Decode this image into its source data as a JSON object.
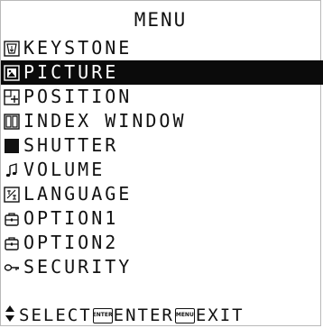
{
  "menu": {
    "title": "MENU",
    "items": [
      {
        "label": "KEYSTONE",
        "icon": "keystone-icon",
        "selected": false
      },
      {
        "label": "PICTURE",
        "icon": "picture-icon",
        "selected": true
      },
      {
        "label": "POSITION",
        "icon": "position-icon",
        "selected": false
      },
      {
        "label": "INDEX WINDOW",
        "icon": "index-window-icon",
        "selected": false
      },
      {
        "label": "SHUTTER",
        "icon": "shutter-icon",
        "selected": false
      },
      {
        "label": "VOLUME",
        "icon": "volume-icon",
        "selected": false
      },
      {
        "label": "LANGUAGE",
        "icon": "language-icon",
        "selected": false
      },
      {
        "label": "OPTION1",
        "icon": "option-icon",
        "selected": false
      },
      {
        "label": "OPTION2",
        "icon": "option-icon",
        "selected": false
      },
      {
        "label": "SECURITY",
        "icon": "key-icon",
        "selected": false
      }
    ]
  },
  "footer": {
    "select_label": "SELECT",
    "enter_key": "ENTER",
    "enter_label": "ENTER",
    "menu_key": "MENU",
    "exit_label": "EXIT"
  },
  "colors": {
    "background": "#ffffff",
    "text": "#111111",
    "highlight": "#0b0b0b",
    "highlight_text": "#ffffff",
    "border": "#b9b9b9"
  }
}
